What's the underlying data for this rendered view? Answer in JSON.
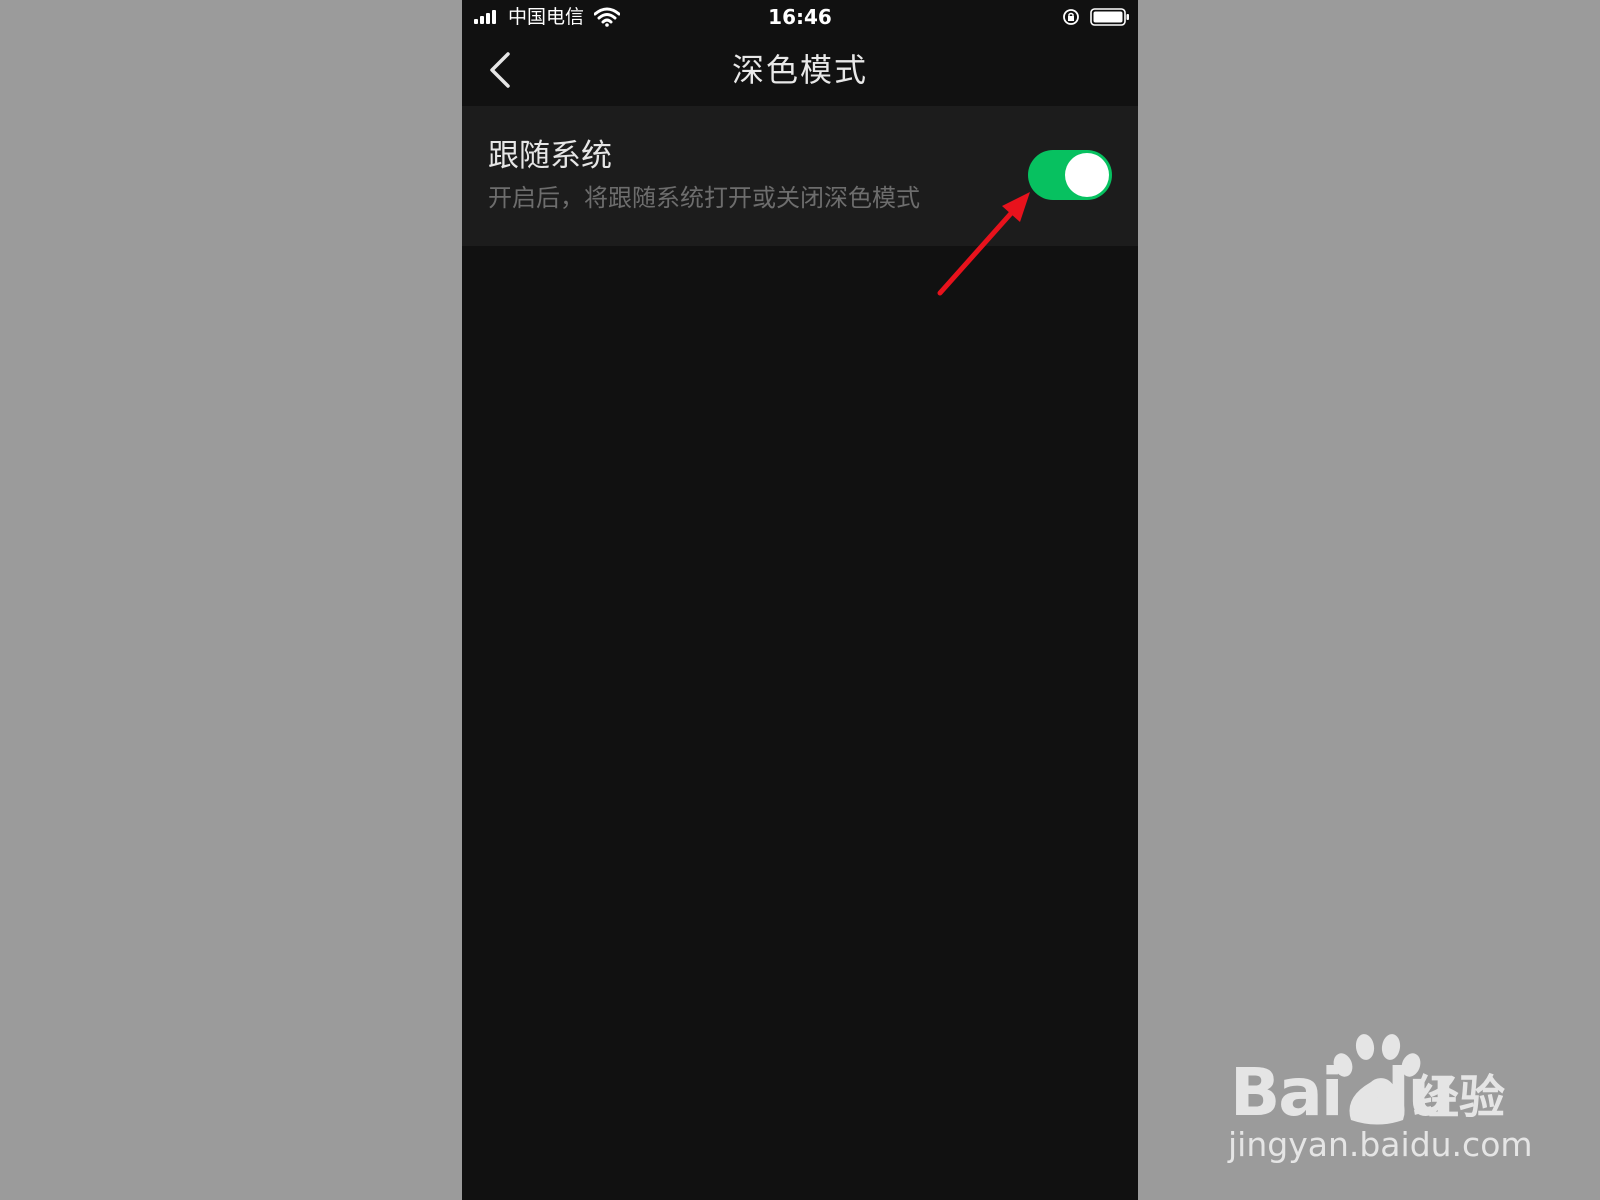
{
  "status_bar": {
    "carrier": "中国电信",
    "time": "16:46",
    "signal_icon": "signal-icon",
    "wifi_icon": "wifi-icon",
    "rotation_lock_icon": "rotation-lock-icon",
    "battery_icon": "battery-icon"
  },
  "nav": {
    "back_icon": "chevron-left-icon",
    "title": "深色模式"
  },
  "setting": {
    "title": "跟随系统",
    "description": "开启后，将跟随系统打开或关闭深色模式",
    "toggle_on": true
  },
  "colors": {
    "background": "#9b9b9b",
    "screen": "#111111",
    "row": "#1c1c1c",
    "toggle_on": "#07c160",
    "arrow": "#e8121c"
  },
  "watermark": {
    "brand": "Bai du",
    "brand_cn": "经验",
    "url": "jingyan.baidu.com"
  }
}
